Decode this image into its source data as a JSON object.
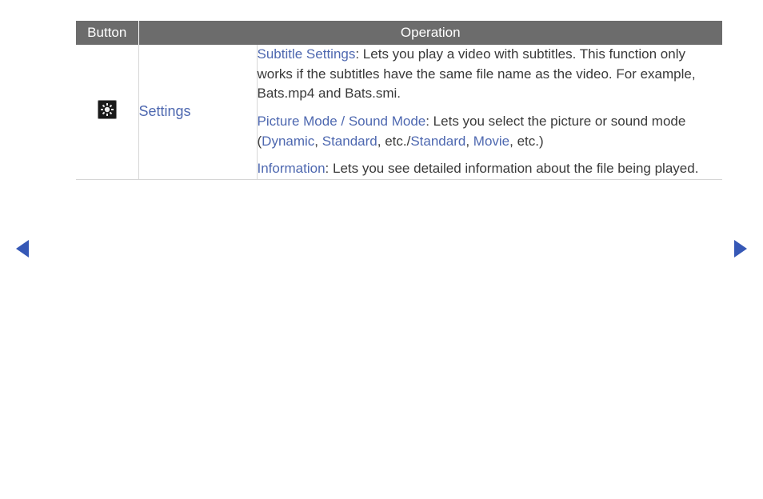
{
  "headers": {
    "button": "Button",
    "operation": "Operation"
  },
  "row": {
    "icon": "settings-gear",
    "name": "Settings",
    "ops": {
      "subtitle": {
        "term": "Subtitle Settings",
        "desc": ": Lets you play a video with subtitles. This function only works if the subtitles have the same file name as the video. For example, Bats.mp4 and Bats.smi."
      },
      "picture": {
        "term": "Picture Mode / Sound Mode",
        "lead": ": Lets you select the picture or sound mode (",
        "v1": "Dynamic",
        "c1": ", ",
        "v2": "Standard",
        "mid": ", etc./",
        "v3": "Standard",
        "c2": ", ",
        "v4": "Movie",
        "tail": ", etc.)"
      },
      "info": {
        "term": "Information",
        "desc": ": Lets you see detailed information about the file being played."
      }
    }
  },
  "nav": {
    "prev": "previous-page",
    "next": "next-page"
  }
}
